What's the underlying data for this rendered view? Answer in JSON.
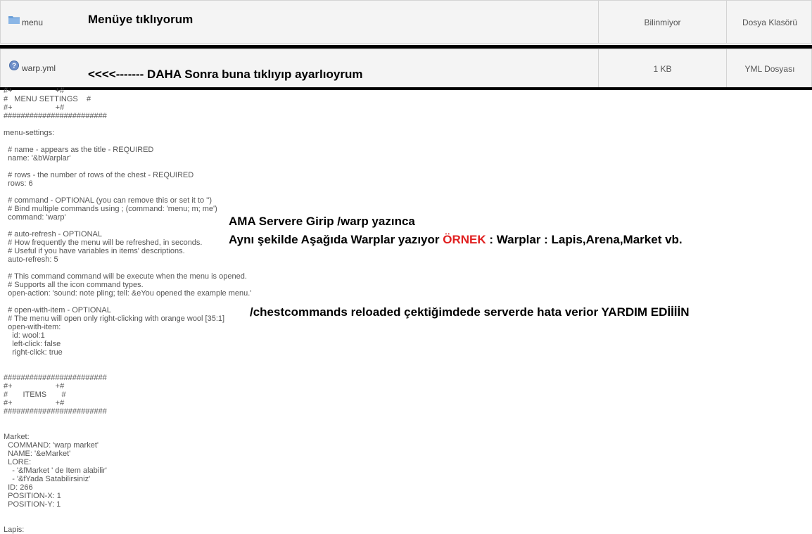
{
  "files": [
    {
      "name": "menu",
      "size": "Bilinmiyor",
      "type": "Dosya Klasörü",
      "icon": "folder-icon"
    },
    {
      "name": "warp.yml",
      "size": "1 KB",
      "type": "YML Dosyası",
      "icon": "help-icon"
    }
  ],
  "annotations": {
    "menu_click": "Menüye tıklıyorum",
    "warp_click": "<<<<------- DAHA Sonra buna tıklıyıp ayarlıoyrum",
    "server_line1": "AMA Servere Girip /warp yazınca",
    "server_line2_a": "Aynı şekilde Aşağıda Warplar yazıyor ",
    "server_line2_red": "ÖRNEK",
    "server_line2_b": " : Warplar : Lapis,Arena,Market vb.",
    "reload_error": "/chestcommands reloaded çektiğimdede serverde hata verior YARDIM EDİİİİN"
  },
  "yml_content": "#+                    +#\n#   MENU SETTINGS    #\n#+                    +#\n########################\n\nmenu-settings:\n\n  # name - appears as the title - REQUIRED\n  name: '&bWarplar'\n\n  # rows - the number of rows of the chest - REQUIRED\n  rows: 6\n\n  # command - OPTIONAL (you can remove this or set it to '')\n  # Bind multiple commands using ; (command: 'menu; m; me')\n  command: 'warp'\n\n  # auto-refresh - OPTIONAL\n  # How frequently the menu will be refreshed, in seconds.\n  # Useful if you have variables in items' descriptions.\n  auto-refresh: 5\n\n  # This command command will be execute when the menu is opened.\n  # Supports all the icon command types.\n  open-action: 'sound: note pling; tell: &eYou opened the example menu.'\n\n  # open-with-item - OPTIONAL\n  # The menu will open only right-clicking with orange wool [35:1]\n  open-with-item:\n    id: wool:1\n    left-click: false\n    right-click: true\n\n\n########################\n#+                    +#\n#       ITEMS       #\n#+                    +#\n########################\n\n\nMarket:\n  COMMAND: 'warp market'\n  NAME: '&eMarket'\n  LORE:\n    - '&fMarket ' de Item alabilir'\n    - '&fYada Satabilirsiniz'\n  ID: 266\n  POSITION-X: 1\n  POSITION-Y: 1\n\n\nLapis:"
}
